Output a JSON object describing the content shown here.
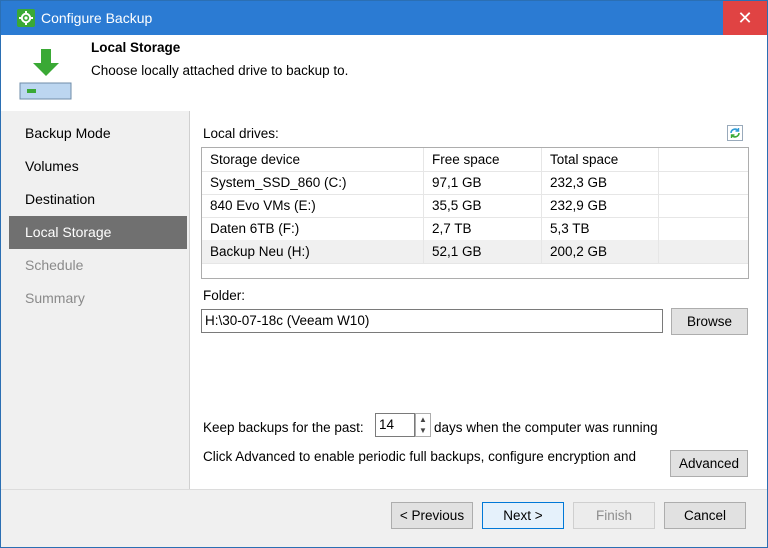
{
  "window": {
    "title": "Configure Backup",
    "close_glyph": "✕"
  },
  "header": {
    "title": "Local Storage",
    "subtitle": "Choose locally attached drive to backup to."
  },
  "nav": {
    "items": [
      {
        "label": "Backup Mode"
      },
      {
        "label": "Volumes"
      },
      {
        "label": "Destination"
      },
      {
        "label": "Local Storage"
      },
      {
        "label": "Schedule"
      },
      {
        "label": "Summary"
      }
    ]
  },
  "drives": {
    "label": "Local drives:",
    "columns": [
      "Storage device",
      "Free space",
      "Total space"
    ],
    "rows": [
      {
        "device": "System_SSD_860 (C:)",
        "free": "97,1 GB",
        "total": "232,3 GB"
      },
      {
        "device": "840 Evo VMs (E:)",
        "free": "35,5 GB",
        "total": "232,9 GB"
      },
      {
        "device": "Daten 6TB (F:)",
        "free": "2,7 TB",
        "total": "5,3 TB"
      },
      {
        "device": "Backup Neu (H:)",
        "free": "52,1 GB",
        "total": "200,2 GB"
      }
    ]
  },
  "folder": {
    "label": "Folder:",
    "value": "H:\\30-07-18c (Veeam W10)",
    "browse_label": "Browse"
  },
  "retention": {
    "prefix": "Keep backups for the past:",
    "value": "14",
    "suffix": "days when the computer was running"
  },
  "advanced": {
    "text": "Click Advanced to enable periodic full backups, configure encryption and",
    "button_label": "Advanced"
  },
  "footer": {
    "previous": "< Previous",
    "next": "Next >",
    "finish": "Finish",
    "cancel": "Cancel"
  },
  "colors": {
    "titlebar": "#2b7bd3",
    "close": "#e04343",
    "nav_active": "#707070",
    "accent_green": "#3aa935"
  }
}
